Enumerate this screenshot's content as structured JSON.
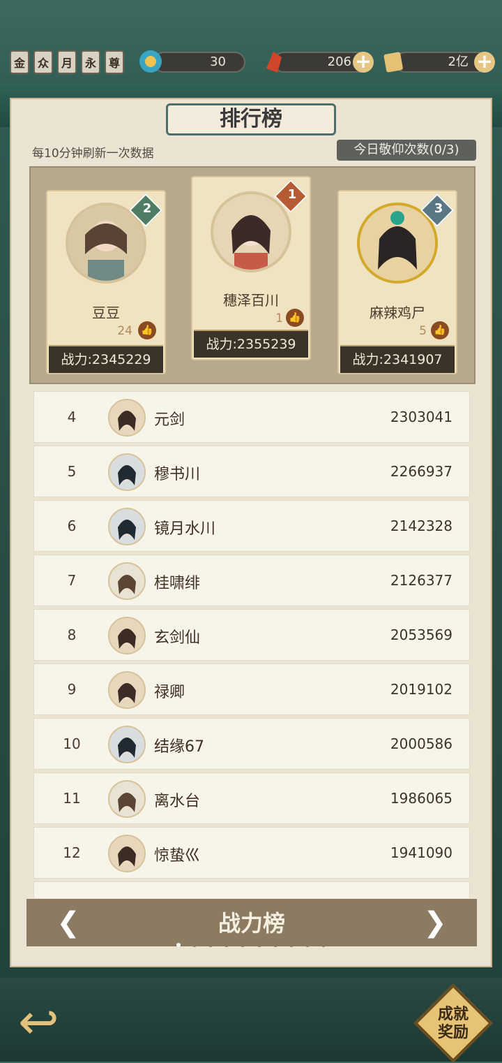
{
  "top_badges": [
    "金",
    "众",
    "月",
    "永",
    "尊"
  ],
  "resources": {
    "res1": {
      "value": "30"
    },
    "res2": {
      "value": "206"
    },
    "res3": {
      "value": "2亿"
    }
  },
  "panel": {
    "title": "排行榜",
    "refresh_note": "每10分钟刷新一次数据",
    "worship_count": "今日敬仰次数(0/3)"
  },
  "podium": {
    "second": {
      "rank": "2",
      "name": "豆豆",
      "likes": "24",
      "power": "战力:2345229"
    },
    "first": {
      "rank": "1",
      "name": "穗泽百川",
      "likes": "1",
      "power": "战力:2355239"
    },
    "third": {
      "rank": "3",
      "name": "麻辣鸡尸",
      "likes": "5",
      "power": "战力:2341907"
    }
  },
  "rows": [
    {
      "rank": "4",
      "name": "元剑",
      "power": "2303041"
    },
    {
      "rank": "5",
      "name": "穆书川",
      "power": "2266937"
    },
    {
      "rank": "6",
      "name": "镜月水川",
      "power": "2142328"
    },
    {
      "rank": "7",
      "name": "桂啸绯",
      "power": "2126377"
    },
    {
      "rank": "8",
      "name": "玄剑仙",
      "power": "2053569"
    },
    {
      "rank": "9",
      "name": "禄卿",
      "power": "2019102"
    },
    {
      "rank": "10",
      "name": "结缘67",
      "power": "2000586"
    },
    {
      "rank": "11",
      "name": "离水台",
      "power": "1986065"
    },
    {
      "rank": "12",
      "name": "惊蛰巛",
      "power": "1941090"
    }
  ],
  "tab": {
    "label": "战力榜"
  },
  "footer": {
    "achievement_line1": "成就",
    "achievement_line2": "奖励"
  }
}
